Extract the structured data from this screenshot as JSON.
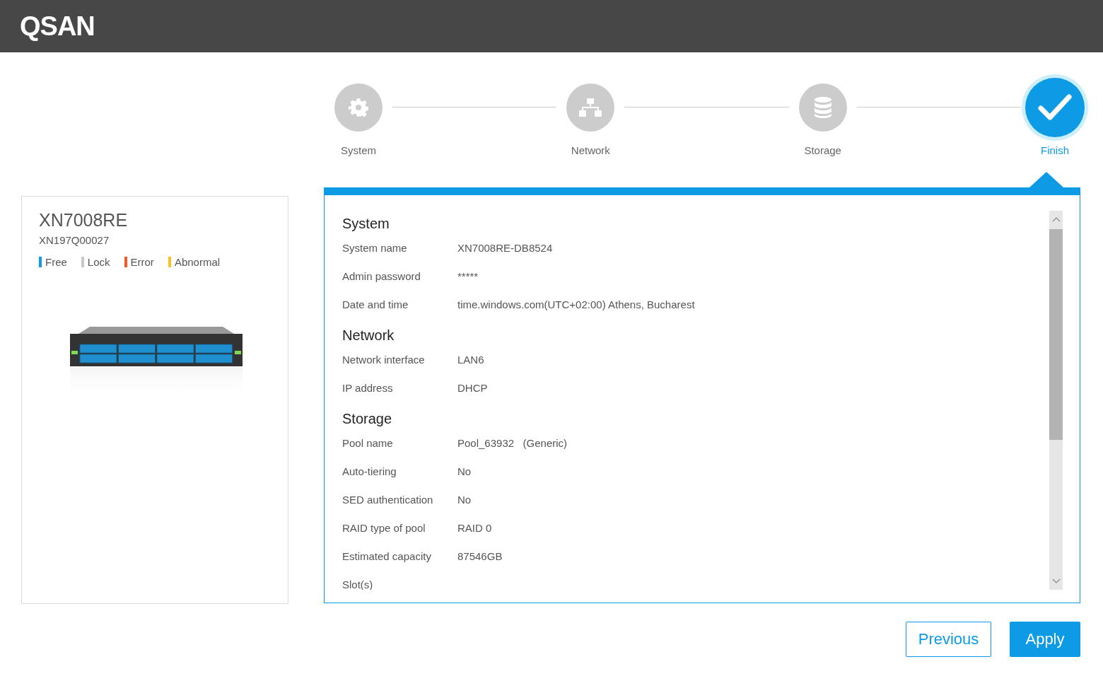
{
  "header": {
    "logo": "QSAN"
  },
  "steps": [
    {
      "label": "System",
      "kind": "gear",
      "selected": false
    },
    {
      "label": "Network",
      "kind": "network",
      "selected": false
    },
    {
      "label": "Storage",
      "kind": "database",
      "selected": false
    },
    {
      "label": "Finish",
      "kind": "check",
      "selected": true
    }
  ],
  "device": {
    "model": "XN7008RE",
    "serial": "XN197Q00027",
    "legend": [
      {
        "label": "Free",
        "color": "#0d9be6"
      },
      {
        "label": "Lock",
        "color": "#c8c8c8"
      },
      {
        "label": "Error",
        "color": "#f05a28"
      },
      {
        "label": "Abnormal",
        "color": "#fbc02d"
      }
    ]
  },
  "summary": [
    {
      "title": "System",
      "rows": [
        {
          "label": "System name",
          "value": "XN7008RE-DB8524"
        },
        {
          "label": "Admin password",
          "value": "*****"
        },
        {
          "label": "Date and time",
          "value": "time.windows.com(UTC+02:00) Athens, Bucharest"
        }
      ]
    },
    {
      "title": "Network",
      "rows": [
        {
          "label": "Network interface",
          "value": "LAN6"
        },
        {
          "label": "IP address",
          "value": "DHCP"
        }
      ]
    },
    {
      "title": "Storage",
      "rows": [
        {
          "label": "Pool name",
          "value": "Pool_63932   (Generic)"
        },
        {
          "label": "Auto-tiering",
          "value": "No"
        },
        {
          "label": "SED authentication",
          "value": "No"
        },
        {
          "label": "RAID type of pool",
          "value": "RAID 0"
        },
        {
          "label": "Estimated capacity",
          "value": "87546GB"
        },
        {
          "label": "Slot(s)"
        }
      ]
    }
  ],
  "buttons": [
    {
      "label": "Previous",
      "kind": "outline"
    },
    {
      "label": "Apply",
      "kind": "primary"
    }
  ]
}
